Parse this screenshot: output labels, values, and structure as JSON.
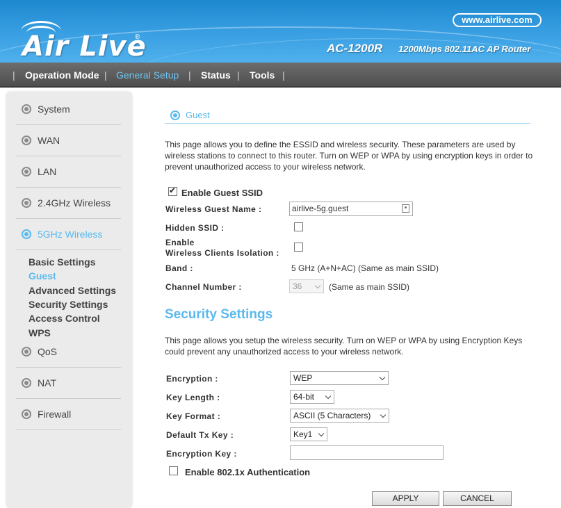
{
  "header": {
    "logo_text": "Air Live",
    "logo_reg": "®",
    "website": "www.airlive.com",
    "model": "AC-1200R",
    "model_desc": "1200Mbps 802.11AC AP Router"
  },
  "nav": {
    "separator": "|",
    "items": [
      {
        "label": "Operation Mode"
      },
      {
        "label": "General Setup"
      },
      {
        "label": "Status"
      },
      {
        "label": "Tools"
      }
    ]
  },
  "sidebar": {
    "items": [
      {
        "label": "System"
      },
      {
        "label": "WAN"
      },
      {
        "label": "LAN"
      },
      {
        "label": "2.4GHz Wireless"
      },
      {
        "label": "5GHz Wireless"
      },
      {
        "label": "QoS"
      },
      {
        "label": "NAT"
      },
      {
        "label": "Firewall"
      }
    ],
    "subitems": [
      {
        "label": "Basic Settings"
      },
      {
        "label": "Guest"
      },
      {
        "label": "Advanced Settings"
      },
      {
        "label": "Security Settings"
      },
      {
        "label": "Access Control"
      },
      {
        "label": "WPS"
      }
    ]
  },
  "guest": {
    "section_title": "Guest",
    "description": "This page allows you to define the ESSID and wireless security. These parameters are used by wireless stations to connect to this router.  Turn on WEP or WPA by using encryption keys in order to prevent unauthorized access to your wireless network.",
    "enable_label": "Enable Guest SSID",
    "enable_checked": true,
    "name_label": "Wireless Guest Name :",
    "name_value": "airlive-5g.guest",
    "hidden_label": "Hidden SSID :",
    "hidden_checked": false,
    "isolation_label_1": "Enable",
    "isolation_label_2": "Wireless Clients Isolation :",
    "isolation_checked": false,
    "band_label": "Band :",
    "band_value": "5 GHz (A+N+AC)  (Same as main SSID)",
    "channel_label": "Channel Number :",
    "channel_value": "36",
    "channel_note": "(Same as main SSID)"
  },
  "security": {
    "title": "Security Settings",
    "description": "This page allows you setup the wireless security. Turn on WEP or WPA by using Encryption Keys could prevent any unauthorized access to your wireless network.",
    "encryption_label": "Encryption :",
    "encryption_value": "WEP",
    "key_length_label": "Key Length :",
    "key_length_value": "64-bit",
    "key_format_label": "Key Format :",
    "key_format_value": "ASCII (5 Characters)",
    "default_tx_label": "Default Tx Key :",
    "default_tx_value": "Key1",
    "enc_key_label": "Encryption Key :",
    "enc_key_value": "",
    "auth_label": "Enable 802.1x Authentication",
    "auth_checked": false
  },
  "buttons": {
    "apply": "APPLY",
    "cancel": "CANCEL"
  },
  "colors": {
    "accent": "#5bb9ee",
    "header_blue": "#3aa0e3",
    "nav_gray": "#5a5a5a"
  }
}
